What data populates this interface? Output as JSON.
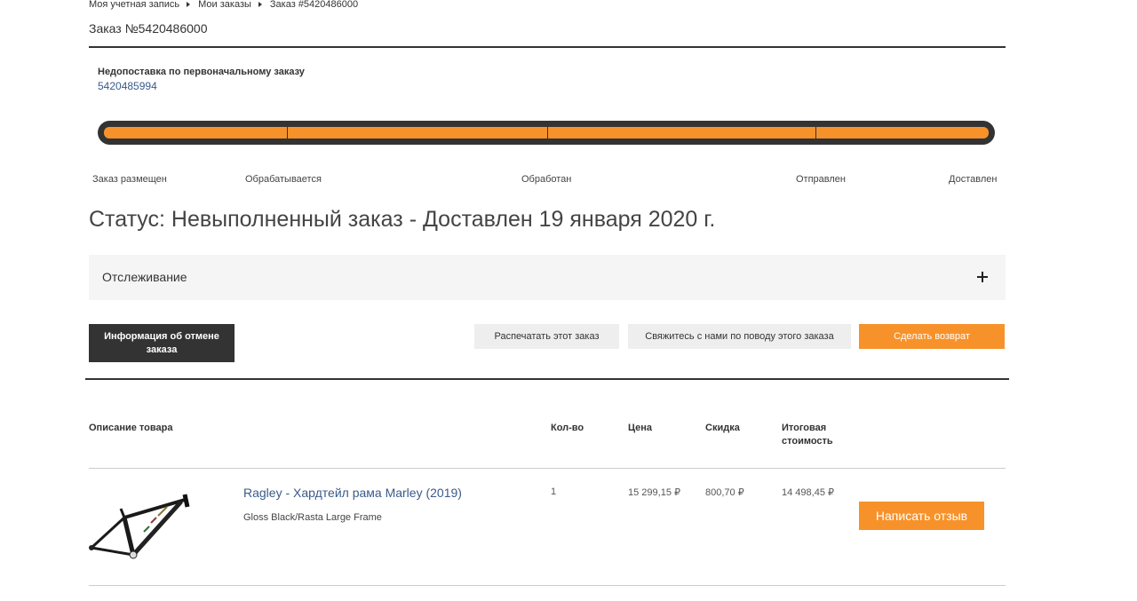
{
  "breadcrumb": {
    "items": [
      "Моя учетная запись",
      "Мои заказы",
      "Заказ #5420486000"
    ]
  },
  "order": {
    "title": "Заказ №5420486000",
    "backorder_label": "Недопоставка по первоначальному заказу",
    "backorder_number": "5420485994"
  },
  "progress": {
    "fraction": 1.0,
    "fill_color": "#f7922a",
    "track_color": "#333333",
    "steps": [
      "Заказ размещен",
      "Обрабатывается",
      "Обработан",
      "Отправлен",
      "Доставлен"
    ]
  },
  "status": {
    "heading": "Статус: Невыполненный заказ - Доставлен 19 января 2020 г."
  },
  "tracking": {
    "label": "Отслеживание",
    "icon": "plus-icon"
  },
  "actions": {
    "cancel_info": "Информация об отмене заказа",
    "print": "Распечатать этот заказ",
    "contact": "Свяжитесь с нами по поводу этого заказа",
    "return": "Сделать возврат"
  },
  "table": {
    "headers": {
      "description": "Описание товара",
      "qty": "Кол-во",
      "price": "Цена",
      "discount": "Скидка",
      "total": "Итоговая стоимость"
    },
    "rows": [
      {
        "name": "Ragley - Хардтейл рама Marley (2019)",
        "variant": "Gloss Black/Rasta Large Frame",
        "qty": "1",
        "price": "15 299,15 ₽",
        "discount": "800,70 ₽",
        "total": "14 498,45 ₽",
        "review_label": "Написать отзыв",
        "image_icon": "bike-frame-icon"
      }
    ]
  },
  "colors": {
    "accent": "#f7922a",
    "dark": "#333333",
    "link": "#3a5a8a"
  }
}
